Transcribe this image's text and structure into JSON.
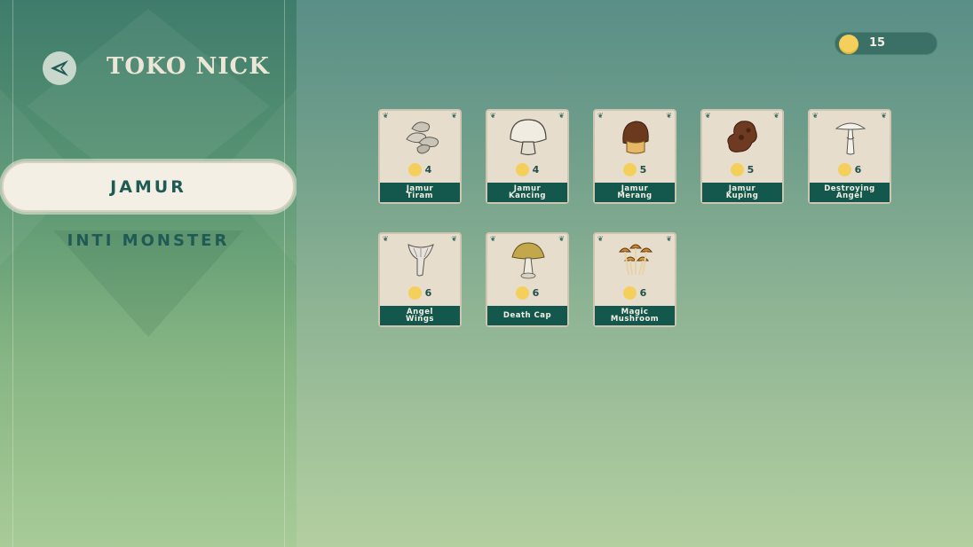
{
  "header": {
    "title": "TOKO NICK",
    "coins": "15"
  },
  "sidebar": {
    "categories": [
      {
        "label": "JAMUR",
        "active": true
      },
      {
        "label": "INTI MONSTER",
        "active": false
      }
    ]
  },
  "colors": {
    "accent": "#14584d",
    "coin": "#f5cf5b",
    "card": "#e6ddcc",
    "text_dark": "#1f5a55"
  },
  "items": [
    {
      "name": "Jamur\nTiram",
      "price": "4",
      "icon": "oyster-mushroom-icon"
    },
    {
      "name": "Jamur\nKancing",
      "price": "4",
      "icon": "button-mushroom-icon"
    },
    {
      "name": "Jamur\nMerang",
      "price": "5",
      "icon": "straw-mushroom-icon"
    },
    {
      "name": "Jamur\nKuping",
      "price": "5",
      "icon": "wood-ear-mushroom-icon"
    },
    {
      "name": "Destroying\nAngel",
      "price": "6",
      "icon": "destroying-angel-icon"
    },
    {
      "name": "Angel\nWings",
      "price": "6",
      "icon": "angel-wings-icon"
    },
    {
      "name": "Death Cap",
      "price": "6",
      "icon": "death-cap-icon"
    },
    {
      "name": "Magic\nMushroom",
      "price": "6",
      "icon": "magic-mushroom-icon"
    }
  ]
}
